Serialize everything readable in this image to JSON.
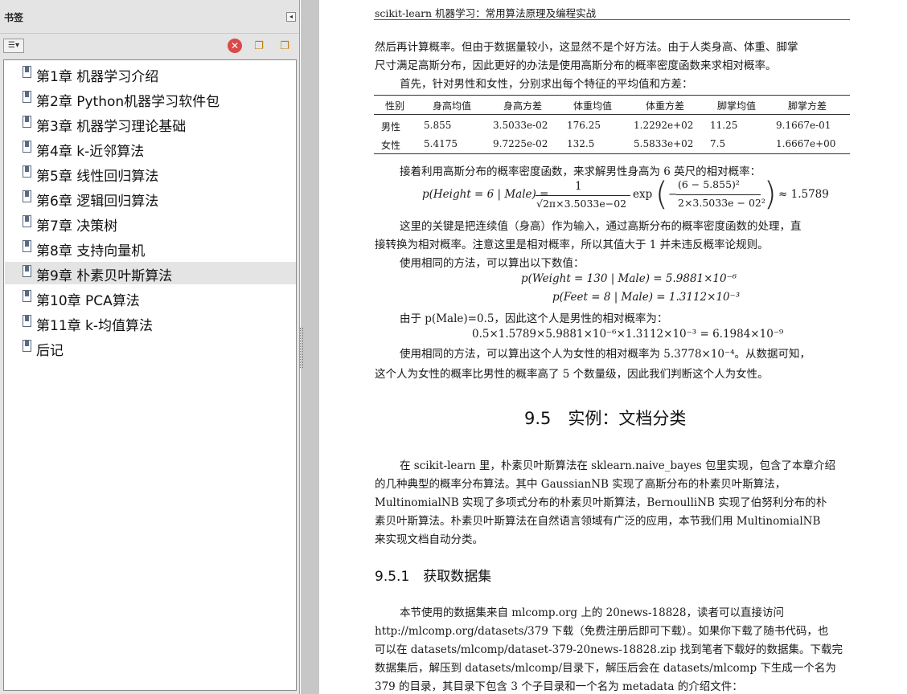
{
  "sidebar": {
    "title": "书签",
    "collapse_glyph": "◂",
    "toolbar": {
      "options_glyph": "☰▾",
      "delete_glyph": "✕",
      "new_glyph": "❐",
      "expand_glyph": "❐"
    },
    "bookmarks": [
      {
        "label": "第1章 机器学习介绍"
      },
      {
        "label": "第2章 Python机器学习软件包"
      },
      {
        "label": "第3章 机器学习理论基础"
      },
      {
        "label": "第4章 k-近邻算法"
      },
      {
        "label": "第5章 线性回归算法"
      },
      {
        "label": "第6章 逻辑回归算法"
      },
      {
        "label": "第7章 决策树"
      },
      {
        "label": "第8章 支持向量机"
      },
      {
        "label": "第9章 朴素贝叶斯算法"
      },
      {
        "label": "第10章 PCA算法"
      },
      {
        "label": "第11章 k-均值算法"
      },
      {
        "label": "后记"
      }
    ],
    "selected": "第9章 朴素贝叶斯算法"
  },
  "page": {
    "running_head": "scikit-learn 机器学习：常用算法原理及编程实战",
    "p1_l1": "然后再计算概率。但由于数据量较小，这显然不是个好方法。由于人类身高、体重、脚掌",
    "p1_l2": "尺寸满足高斯分布，因此更好的办法是使用高斯分布的概率密度函数来求相对概率。",
    "p2": "首先，针对男性和女性，分别求出每个特征的平均值和方差：",
    "table": {
      "headers": [
        "性别",
        "身高均值",
        "身高方差",
        "体重均值",
        "体重方差",
        "脚掌均值",
        "脚掌方差"
      ],
      "rows": [
        [
          "男性",
          "5.855",
          "3.5033e-02",
          "176.25",
          "1.2292e+02",
          "11.25",
          "9.1667e-01"
        ],
        [
          "女性",
          "5.4175",
          "9.7225e-02",
          "132.5",
          "5.5833e+02",
          "7.5",
          "1.6667e+00"
        ]
      ]
    },
    "p3": "接着利用高斯分布的概率密度函数，来求解男性身高为 6 英尺的相对概率：",
    "f1": {
      "lhs": "p(Height = 6 | Male) =",
      "num": "1",
      "den": "√2π×3.5033e−02",
      "exp": "exp",
      "inner_num": "(6 − 5.855)²",
      "inner_den": "2×3.5033e − 02²",
      "minus": "−",
      "result": "≈ 1.5789"
    },
    "p4_l1": "这里的关键是把连续值（身高）作为输入，通过高斯分布的概率密度函数的处理，直",
    "p4_l2": "接转换为相对概率。注意这里是相对概率，所以其值大于 1 并未违反概率论规则。",
    "p5": "使用相同的方法，可以算出以下数值：",
    "f2": "p(Weight = 130 | Male) = 5.9881×10⁻⁶",
    "f3": "p(Feet = 8 | Male) = 1.3112×10⁻³",
    "p6": "由于 p(Male)=0.5，因此这个人是男性的相对概率为：",
    "f4": "0.5×1.5789×5.9881×10⁻⁶×1.3112×10⁻³ = 6.1984×10⁻⁹",
    "p7_l1": "使用相同的方法，可以算出这个人为女性的相对概率为 5.3778×10⁻⁴。从数据可知，",
    "p7_l2": "这个人为女性的概率比男性的概率高了 5 个数量级，因此我们判断这个人为女性。",
    "section": "9.5　实例：文档分类",
    "p8_l1": "在 scikit-learn 里，朴素贝叶斯算法在 sklearn.naive_bayes 包里实现，包含了本章介绍",
    "p8_l2": "的几种典型的概率分布算法。其中 GaussianNB 实现了高斯分布的朴素贝叶斯算法，",
    "p8_l3": "MultinomialNB 实现了多项式分布的朴素贝叶斯算法，BernoulliNB 实现了伯努利分布的朴",
    "p8_l4": "素贝叶斯算法。朴素贝叶斯算法在自然语言领域有广泛的应用，本节我们用 MultinomialNB",
    "p8_l5": "来实现文档自动分类。",
    "subsection": "9.5.1　获取数据集",
    "p9_l1": "本节使用的数据集来自 mlcomp.org 上的 20news-18828，读者可以直接访问",
    "p9_l2": "http://mlcomp.org/datasets/379 下载（免费注册后即可下载）。如果你下载了随书代码，也",
    "p9_l3": "可以在 datasets/mlcomp/dataset-379-20news-18828.zip 找到笔者下载好的数据集。下载完",
    "p9_l4": "数据集后，解压到 datasets/mlcomp/目录下，解压后会在 datasets/mlcomp 下生成一个名为",
    "p9_l5": "379 的目录，其目录下包含 3 个子目录和一个名为 metadata 的介绍文件："
  }
}
